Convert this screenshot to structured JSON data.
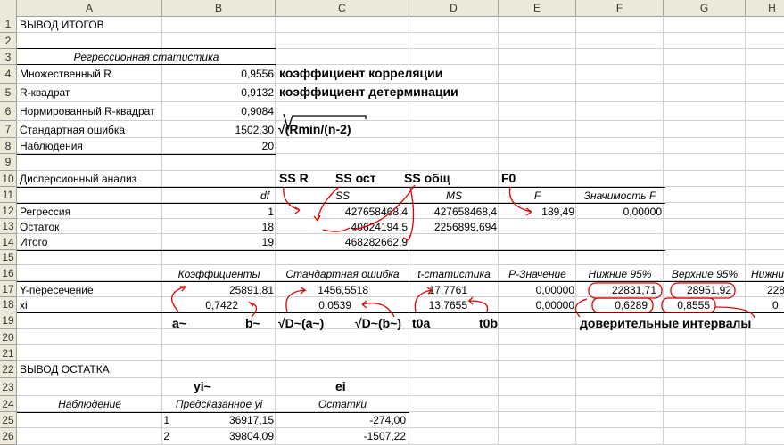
{
  "columns": [
    "A",
    "B",
    "C",
    "D",
    "E",
    "F",
    "G",
    "H"
  ],
  "rows": [
    "1",
    "2",
    "3",
    "4",
    "5",
    "6",
    "7",
    "8",
    "9",
    "10",
    "11",
    "12",
    "13",
    "14",
    "15",
    "16",
    "17",
    "18",
    "19",
    "20",
    "21",
    "22",
    "23",
    "24",
    "25",
    "26"
  ],
  "summary": {
    "title": "ВЫВОД ИТОГОВ",
    "reg_stat_header": "Регрессионная статистика",
    "multiple_r_label": "Множественный R",
    "multiple_r": "0,9556",
    "r2_label": "R-квадрат",
    "r2": "0,9132",
    "adj_r2_label": "Нормированный R-квадрат",
    "adj_r2": "0,9084",
    "std_err_label": "Стандартная ошибка",
    "std_err": "1502,30",
    "obs_label": "Наблюдения",
    "obs": "20"
  },
  "notes": {
    "correlation": "коэффициент корреляции",
    "determination": "коэффициент детерминации",
    "formula": "√(Rmin/(n-2)",
    "ssr": "SS R",
    "ss_ost": "SS ост",
    "ss_total": "SS общ",
    "f0": "F0",
    "a": "a~",
    "b": "b~",
    "d_a": "√D~(a~)",
    "d_b": "√D~(b~)",
    "t0a": "t0a",
    "t0b": "t0b",
    "intervals": "доверительные интервалы",
    "yi": "yi~",
    "ei": "ei"
  },
  "anova": {
    "title": "Дисперсионный анализ",
    "headers": [
      "df",
      "SS",
      "MS",
      "F",
      "Значимость F"
    ],
    "rows": [
      {
        "label": "Регрессия",
        "df": "1",
        "ss": "427658468,4",
        "ms": "427658468,4",
        "f": "189,49",
        "sig": "0,00000"
      },
      {
        "label": "Остаток",
        "df": "18",
        "ss": "40624194,5",
        "ms": "2256899,694"
      },
      {
        "label": "Итого",
        "df": "19",
        "ss": "468282662,9"
      }
    ]
  },
  "coef": {
    "headers": [
      "Коэффициенты",
      "Стандартная ошибка",
      "t-статистика",
      "P-Значение",
      "Нижние 95%",
      "Верхние 95%",
      "Нижни"
    ],
    "rows": [
      {
        "label": "Y-пересечение",
        "coef": "25891,81",
        "se": "1456,5518",
        "t": "17,7761",
        "p": "0,00000",
        "low": "22831,71",
        "high": "28951,92",
        "low2": "228"
      },
      {
        "label": "xi",
        "coef": "0,7422",
        "se": "0,0539",
        "t": "13,7655",
        "p": "0,00000",
        "low": "0,6289",
        "high": "0,8555",
        "low2": "0,"
      }
    ]
  },
  "residuals": {
    "title": "ВЫВОД ОСТАТКА",
    "headers": [
      "Наблюдение",
      "Предсказанное yi",
      "Остатки"
    ],
    "rows": [
      {
        "n": "1",
        "pred": "36917,15",
        "res": "-274,00"
      },
      {
        "n": "2",
        "pred": "39804,09",
        "res": "-1507,22"
      }
    ]
  },
  "colors": {
    "annotation": "#e00000",
    "header_bg": "#ece9d8",
    "grid": "#d0d0d0"
  }
}
